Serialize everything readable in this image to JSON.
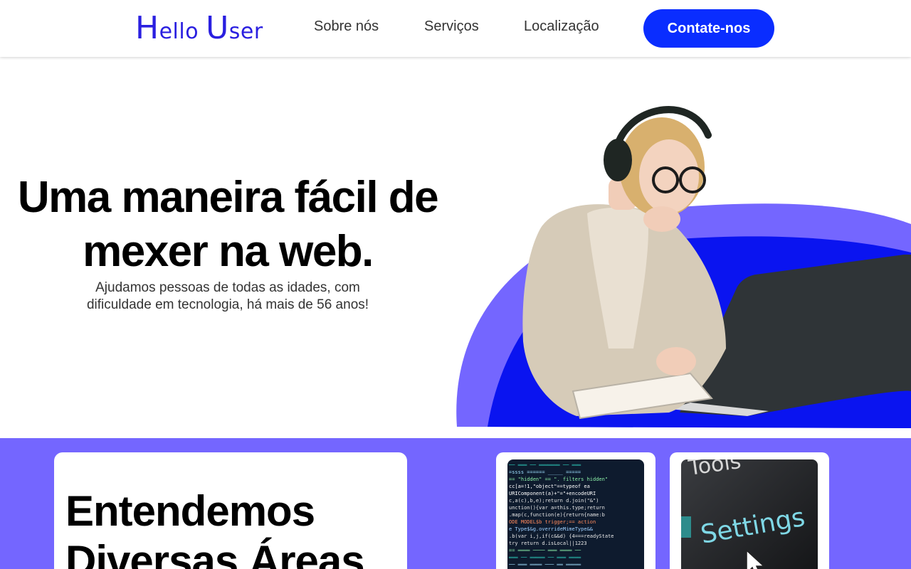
{
  "header": {
    "logo": {
      "first_initial": "H",
      "first_rest": "ello",
      "second_initial": "U",
      "second_rest": "ser"
    },
    "nav": [
      "Sobre nós",
      "Serviços",
      "Localização"
    ],
    "cta_label": "Contate-nos"
  },
  "hero": {
    "title_line1": "Uma maneira fácil de",
    "title_line2": "mexer na web.",
    "subtitle_line1": "Ajudamos pessoas de todas as idades, com",
    "subtitle_line2": "dificuldade em tecnologia, há mais de 56 anos!",
    "image_icon": "woman-with-laptop-illustration"
  },
  "areas": {
    "title_line1": "Entendemos",
    "title_line2": "Diversas Áreas",
    "card1_icon": "code-screen-image",
    "card2_icon": "settings-screen-image",
    "card2_caption_top": "Tools",
    "card2_caption": "Settings"
  },
  "colors": {
    "brand_blue": "#0a2dff",
    "logo_blue": "#2a1fe0",
    "purple": "#7466ff",
    "deep_blue": "#0a14f0"
  }
}
